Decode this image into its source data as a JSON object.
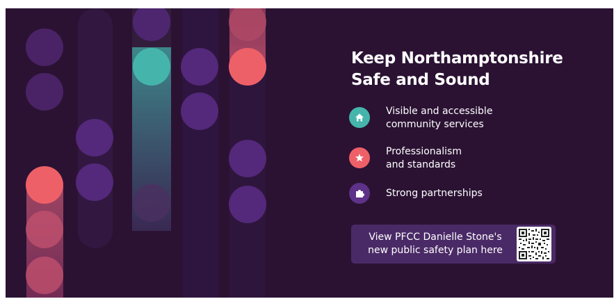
{
  "page": {
    "title": "Keep Northamptonshire\nSafe and Sound",
    "features": [
      {
        "label": "Visible and accessible\ncommunity services",
        "icon": "home-icon",
        "color": "#45b5ab"
      },
      {
        "label": "Professionalism\nand standards",
        "icon": "star-icon",
        "color": "#ee6068"
      },
      {
        "label": "Strong partnerships",
        "icon": "puzzle-piece-icon",
        "color": "#5e3288"
      }
    ],
    "cta": {
      "text": "View PFCC Danielle Stone's\nnew public safety plan here",
      "qr_icon": "qr-code-icon"
    }
  },
  "colors": {
    "background": "#2b1233",
    "teal": "#45b5ab",
    "coral": "#ee6068",
    "purple": "#5e3288",
    "cta_box": "#4a2a66"
  }
}
